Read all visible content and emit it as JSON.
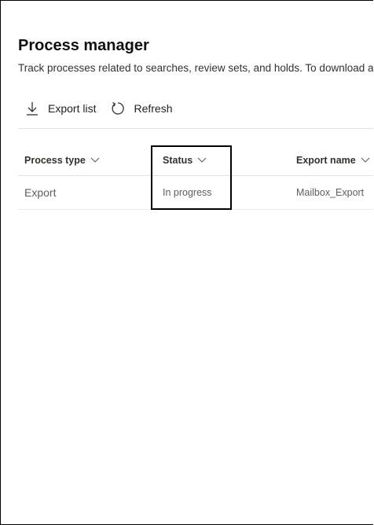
{
  "page": {
    "title": "Process manager",
    "subtitle": "Track processes related to searches, review sets, and holds. To download a"
  },
  "toolbar": {
    "export_label": "Export list",
    "refresh_label": "Refresh"
  },
  "table": {
    "columns": [
      {
        "label": "Process type"
      },
      {
        "label": "Status"
      },
      {
        "label": "Export name"
      }
    ],
    "rows": [
      {
        "type": "Export",
        "status": "In progress",
        "name": "Mailbox_Export"
      }
    ]
  },
  "icons": {
    "export": "download-icon",
    "refresh": "refresh-icon",
    "sort": "chevron-down-icon"
  },
  "colors": {
    "text_primary": "#201f1e",
    "text_secondary": "#605e5c",
    "divider": "#e1dfdd",
    "highlight_border": "#000000"
  }
}
